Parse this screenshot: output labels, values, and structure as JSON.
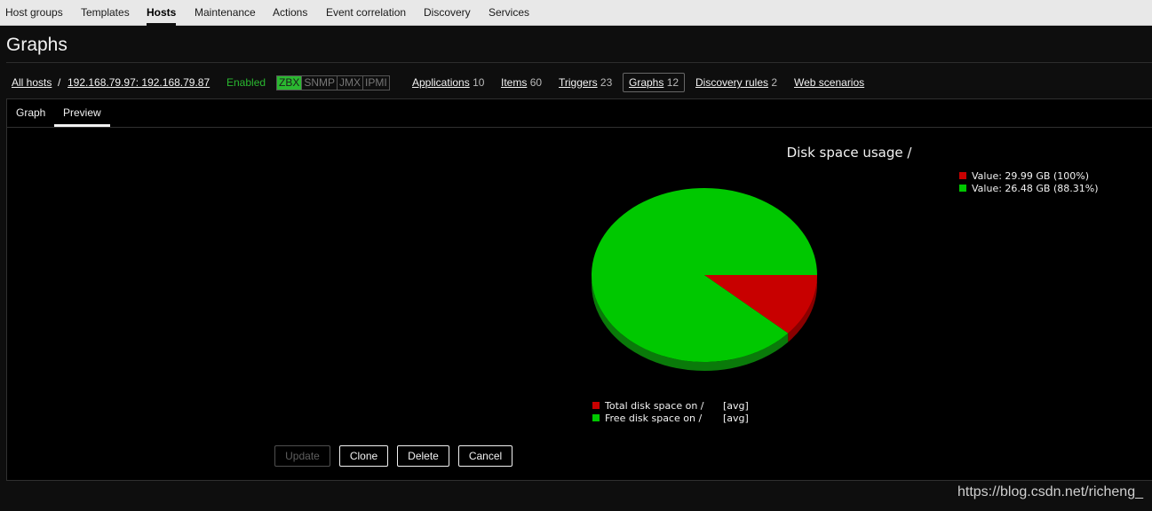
{
  "nav": {
    "items": [
      "Host groups",
      "Templates",
      "Hosts",
      "Maintenance",
      "Actions",
      "Event correlation",
      "Discovery",
      "Services"
    ],
    "active": "Hosts"
  },
  "page": {
    "title": "Graphs"
  },
  "hostbar": {
    "all_hosts": "All hosts",
    "separator": "/",
    "host": "192.168.79.97: 192.168.79.87",
    "status": "Enabled",
    "availability": [
      {
        "label": "ZBX",
        "on": true
      },
      {
        "label": "SNMP",
        "on": false
      },
      {
        "label": "JMX",
        "on": false
      },
      {
        "label": "IPMI",
        "on": false
      }
    ],
    "links": [
      {
        "label": "Applications",
        "count": "10"
      },
      {
        "label": "Items",
        "count": "60"
      },
      {
        "label": "Triggers",
        "count": "23"
      },
      {
        "label": "Graphs",
        "count": "12"
      },
      {
        "label": "Discovery rules",
        "count": "2"
      },
      {
        "label": "Web scenarios",
        "count": ""
      }
    ]
  },
  "tabs": {
    "graph": "Graph",
    "preview": "Preview",
    "active": "Preview"
  },
  "chart_data": {
    "type": "pie",
    "title": "Disk space usage /",
    "legend_top": [
      "Value: 29.99 GB (100%)",
      "Value: 26.48 GB (88.31%)"
    ],
    "legend_bottom": [
      {
        "name": "Total disk space on /",
        "func": "[avg]"
      },
      {
        "name": "Free disk space on /",
        "func": "[avg]"
      }
    ],
    "series": [
      {
        "value": 29.99,
        "unit": "GB",
        "percent": 100,
        "color": "#c80000"
      },
      {
        "value": 26.48,
        "unit": "GB",
        "percent": 88.31,
        "color": "#00c800"
      }
    ],
    "slice_percent_of_circle": [
      11.69,
      88.31
    ],
    "style": "3d"
  },
  "buttons": {
    "update": "Update",
    "clone": "Clone",
    "delete": "Delete",
    "cancel": "Cancel"
  },
  "watermark": "https://blog.csdn.net/richeng_"
}
